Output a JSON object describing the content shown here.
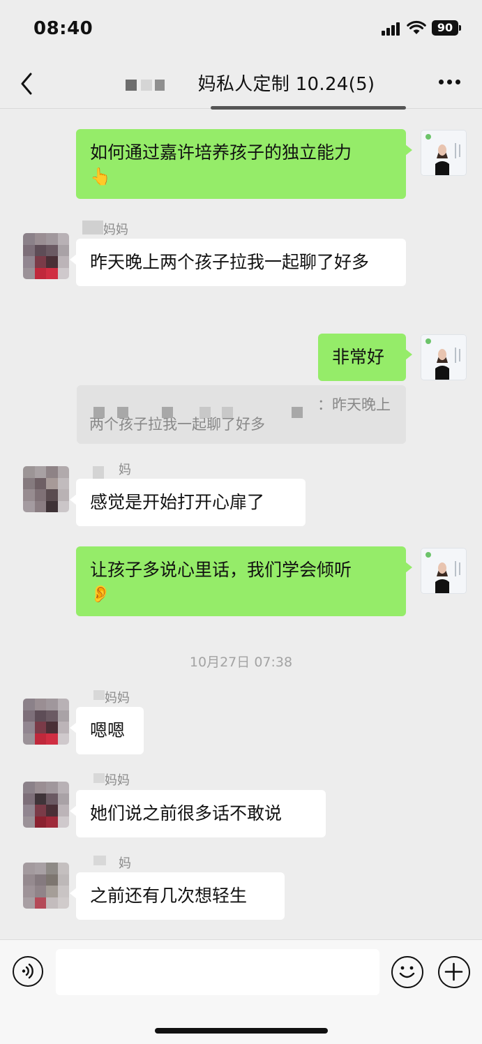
{
  "status_bar": {
    "time": "08:40",
    "battery": "90"
  },
  "header": {
    "title": "妈私人定制 10.24(5)"
  },
  "messages": [
    {
      "side": "right",
      "text": "如何通过嘉许培养孩子的独立能力",
      "emoji": "👆"
    },
    {
      "side": "left",
      "sender": "妈妈",
      "text": "昨天晚上两个孩子拉我一起聊了好多"
    },
    {
      "side": "right",
      "text": "非常好"
    },
    {
      "side": "left",
      "sender": "妈",
      "text": "感觉是开始打开心扉了"
    },
    {
      "side": "right",
      "text": "让孩子多说心里话，我们学会倾听",
      "emoji": "👂"
    },
    {
      "side": "left",
      "sender": "妈妈",
      "text": "嗯嗯"
    },
    {
      "side": "left",
      "sender": "妈妈",
      "text": "她们说之前很多话不敢说"
    },
    {
      "side": "left",
      "sender": "妈",
      "text": "之前还有几次想轻生"
    }
  ],
  "quote": {
    "line1": "：昨天晚上",
    "line2": "两个孩子拉我一起聊了好多"
  },
  "timestamp": "10月27日 07:38",
  "input_bar": {
    "placeholder": ""
  },
  "colors": {
    "self_bubble": "#95ec69",
    "other_bubble": "#ffffff",
    "background": "#ededed"
  },
  "icons": [
    "back-icon",
    "more-icon",
    "voice-icon",
    "emoji-icon",
    "plus-icon"
  ]
}
